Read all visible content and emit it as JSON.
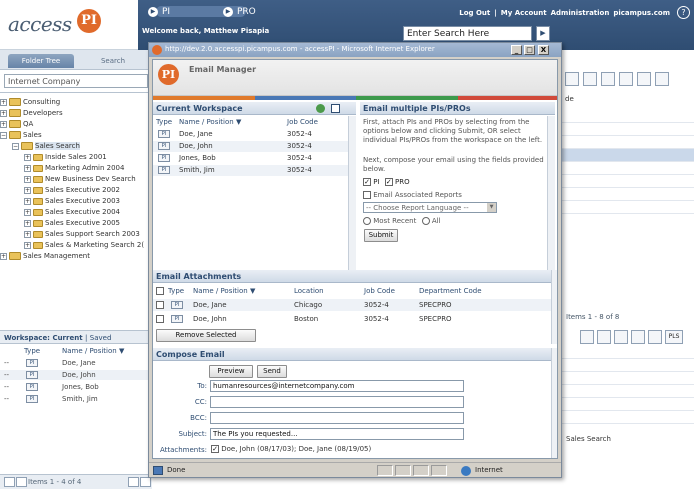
{
  "brand": {
    "word": "access",
    "badge": "PI"
  },
  "topnav": {
    "pi_label": "PI",
    "pro_label": "PRO",
    "welcome": "Welcome back, Matthew Pisapia",
    "links": [
      "Log Out",
      "|",
      "My Account",
      "Administration",
      "picampus.com"
    ],
    "help": "?",
    "search_value": "Enter Search Here",
    "search_go": "▶"
  },
  "left": {
    "tab_folder": "Folder Tree",
    "tab_search": "Search",
    "company": "Internet Company",
    "tree": [
      {
        "exp": "+",
        "label": "Consulting"
      },
      {
        "exp": "+",
        "label": "Developers"
      },
      {
        "exp": "+",
        "label": "QA"
      },
      {
        "exp": "−",
        "label": "Sales"
      },
      {
        "exp": "−",
        "label": "Sales Search"
      },
      {
        "exp": "+",
        "label": "Inside Sales 2001"
      },
      {
        "exp": "+",
        "label": "Marketing Admin 2004"
      },
      {
        "exp": "+",
        "label": "New Business Dev Search"
      },
      {
        "exp": "+",
        "label": "Sales Executive 2002"
      },
      {
        "exp": "+",
        "label": "Sales Executive 2003"
      },
      {
        "exp": "+",
        "label": "Sales Executive 2004"
      },
      {
        "exp": "+",
        "label": "Sales Executive 2005"
      },
      {
        "exp": "+",
        "label": "Sales Support Search 2003"
      },
      {
        "exp": "+",
        "label": "Sales & Marketing Search 2("
      },
      {
        "exp": "+",
        "label": "Sales Management"
      }
    ],
    "workspace": {
      "title": "Workspace:",
      "current": "Current",
      "sep": "|",
      "saved": "Saved",
      "col_type": "Type",
      "col_name": "Name / Position ▼",
      "rows": [
        {
          "dash": "--",
          "badge": "PI",
          "name": "Doe, Jane"
        },
        {
          "dash": "--",
          "badge": "PI",
          "name": "Doe, John"
        },
        {
          "dash": "--",
          "badge": "PI",
          "name": "Jones, Bob"
        },
        {
          "dash": "--",
          "badge": "PI",
          "name": "Smith, Jim"
        }
      ],
      "footer": "Items 1 - 4 of 4"
    }
  },
  "right": {
    "col_label": "de",
    "items": "Items 1 - 8 of 8",
    "sales_search": "Sales Search",
    "pls": "PLS"
  },
  "popup": {
    "title": "http://dev.2.0.accesspi.picampus.com - accessPI - Microsoft Internet Explorer",
    "btn_min": "_",
    "btn_max": "□",
    "btn_close": "X",
    "header_title": "Email Manager",
    "header_logo": "PI",
    "colors": [
      "#e07a2c",
      "#4a78b5",
      "#3d9a4c",
      "#d14a3a"
    ],
    "workspace": {
      "title": "Current Workspace",
      "col_type": "Type",
      "col_name": "Name / Position ▼",
      "col_job": "Job Code",
      "rows": [
        {
          "badge": "PI",
          "name": "Doe, Jane",
          "job": "3052-4"
        },
        {
          "badge": "PI",
          "name": "Doe, John",
          "job": "3052-4"
        },
        {
          "badge": "PI",
          "name": "Jones, Bob",
          "job": "3052-4"
        },
        {
          "badge": "PI",
          "name": "Smith, Jim",
          "job": "3052-4"
        }
      ]
    },
    "multi": {
      "title": "Email multiple PIs/PROs",
      "p1": "First, attach PIs and PROs by selecting from the options below and clicking Submit, OR select individual PIs/PROs from the workspace on the left.",
      "p2": "Next, compose your email using the fields provided below.",
      "pi": "PI",
      "pro": "PRO",
      "reports": "Email Associated Reports",
      "language": "-- Choose Report Language --",
      "recent": "Most Recent",
      "all": "All",
      "submit": "Submit"
    },
    "attachments": {
      "title": "Email Attachments",
      "col_type": "Type",
      "col_name": "Name / Position ▼",
      "col_loc": "Location",
      "col_job": "Job Code",
      "col_dept": "Department Code",
      "rows": [
        {
          "badge": "PI",
          "name": "Doe, Jane",
          "loc": "Chicago",
          "job": "3052-4",
          "dept": "SPECPRO"
        },
        {
          "badge": "PI",
          "name": "Doe, John",
          "loc": "Boston",
          "job": "3052-4",
          "dept": "SPECPRO"
        }
      ],
      "remove": "Remove Selected"
    },
    "compose": {
      "title": "Compose Email",
      "preview": "Preview",
      "send": "Send",
      "to_label": "To:",
      "to": "humanresources@internetcompany.com",
      "cc_label": "CC:",
      "cc": "",
      "bcc_label": "BCC:",
      "bcc": "",
      "subject_label": "Subject:",
      "subject": "The PIs you requested...",
      "attach_label": "Attachments:",
      "attach": "Doe, John (08/17/03); Doe, Jane (08/19/05)"
    },
    "status_done": "Done",
    "status_zone": "Internet"
  }
}
